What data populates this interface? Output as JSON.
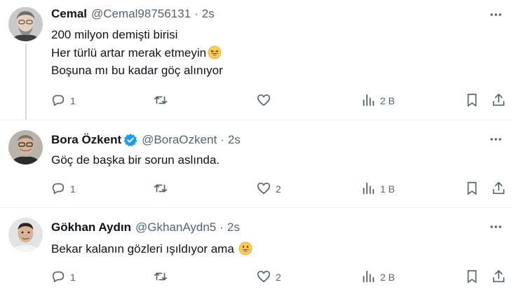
{
  "tweets": [
    {
      "name": "Cemal",
      "handle": "@Cemal98756131",
      "separator": "·",
      "time": "2s",
      "verified": false,
      "lines": [
        "200 milyon demişti birisi",
        "Her türlü artar merak etmeyin",
        "Boşuna mı bu kadar göç alınıyor"
      ],
      "emoji": "grinning-squinting-emoji",
      "reply_count": "1",
      "retweet_count": "",
      "like_count": "",
      "views": "2 B"
    },
    {
      "name": "Bora Özkent",
      "handle": "@BoraOzkent",
      "separator": "·",
      "time": "2s",
      "verified": true,
      "lines": [
        "Göç de başka bir sorun aslında."
      ],
      "reply_count": "1",
      "retweet_count": "",
      "like_count": "2",
      "views": "1 B"
    },
    {
      "name": "Gökhan Aydın",
      "handle": "@GkhanAydn5",
      "separator": "·",
      "time": "2s",
      "verified": false,
      "lines": [
        "Bekar kalanın gözleri ışıldıyor ama"
      ],
      "emoji": "grinning-emoji",
      "reply_count": "1",
      "retweet_count": "",
      "like_count": "2",
      "views": "2 B"
    }
  ],
  "colors": {
    "text": "#0f1419",
    "muted": "#536471",
    "verified": "#1d9bf0",
    "divider": "#eff3f4",
    "thread_line": "#cfd9de"
  },
  "icons": {
    "reply": "reply-icon",
    "retweet": "retweet-icon",
    "like": "heart-icon",
    "views": "views-chart-icon",
    "bookmark": "bookmark-icon",
    "share": "share-icon",
    "more": "more-dots-icon"
  }
}
